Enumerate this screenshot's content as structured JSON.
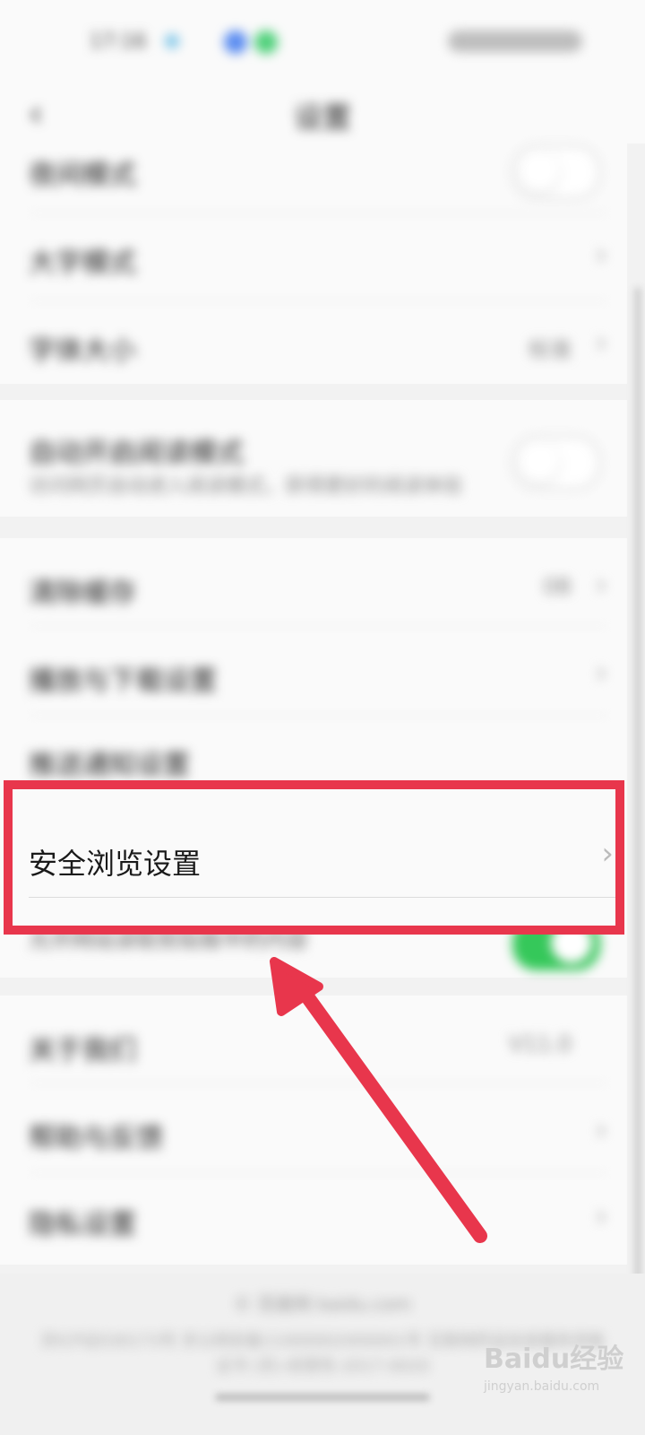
{
  "status_bar": {
    "time": "17:16"
  },
  "header": {
    "title": "设置"
  },
  "rows": {
    "r1": {
      "label": "夜间模式"
    },
    "r2": {
      "label": "大字模式"
    },
    "r3": {
      "label": "字体大小",
      "value": "标准"
    },
    "r4": {
      "label": "自动开启阅读模式",
      "sub": "访问网页自动进入阅读模式，获得更好的阅读体验"
    },
    "r5": {
      "label": "清除缓存",
      "value": "0B"
    },
    "r6": {
      "label": "播放与下载设置"
    },
    "r7": {
      "label": "推送通知设置"
    },
    "r8": {
      "label": "安全浏览设置"
    },
    "r9": {
      "label": "允许网站读取剪贴板中的内容"
    },
    "r10": {
      "label": "关于我们",
      "value": "V11.0"
    },
    "r11": {
      "label": "帮助与反馈"
    },
    "r12": {
      "label": "隐私设置"
    }
  },
  "toggles": {
    "night_mode": "off",
    "auto_reading_mode": "off",
    "clipboard": "on"
  },
  "footer": {
    "line1": "© 百度网 baidu.com",
    "line2": "京ICP证030173号 京公网安备11000002000001号 互联网药品信息服务资格证书 (京)-经营性-2017-0020"
  },
  "watermark": {
    "logo": "Baidu经验",
    "site": "jingyan.baidu.com"
  },
  "colors": {
    "highlight": "#e8364c",
    "toggle_on": "#35c85a"
  }
}
